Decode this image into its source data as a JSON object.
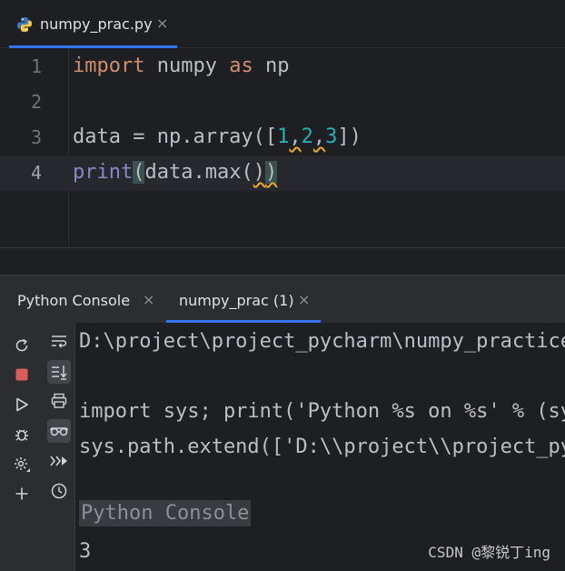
{
  "editor": {
    "tab": {
      "label": "numpy_prac.py",
      "close": "×"
    },
    "lines": [
      {
        "num": "1"
      },
      {
        "num": "2"
      },
      {
        "num": "3"
      },
      {
        "num": "4"
      }
    ],
    "code": {
      "l1_kw1": "import",
      "l1_mod": " numpy ",
      "l1_kw2": "as",
      "l1_alias": " np",
      "l3_pre": "data = np.array([",
      "l3_n1": "1",
      "l3_c1": ",",
      "l3_n2": "2",
      "l3_c2": ",",
      "l3_n3": "3",
      "l3_post": "])",
      "l4_fn": "print",
      "l4_open": "(",
      "l4_mid": "data.max(",
      "l4_close_inner": ")",
      "l4_close": ")"
    }
  },
  "console": {
    "tabs": [
      {
        "label": "Python Console",
        "close": "×"
      },
      {
        "label": "numpy_prac (1)",
        "close": "×"
      }
    ],
    "output": [
      "D:\\project\\project_pycharm\\numpy_practice",
      "",
      "import sys; print('Python %s on %s' % (sys.version, sys.platform))",
      "sys.path.extend(['D:\\\\project\\\\project_pycharm'])",
      "",
      "Python Console",
      "3"
    ]
  },
  "watermark": "CSDN @黎锐丁ing",
  "colors": {
    "accent": "#3574f0",
    "keyword": "#cf8e6d",
    "number": "#2aacb8",
    "stop": "#db5c5c"
  }
}
